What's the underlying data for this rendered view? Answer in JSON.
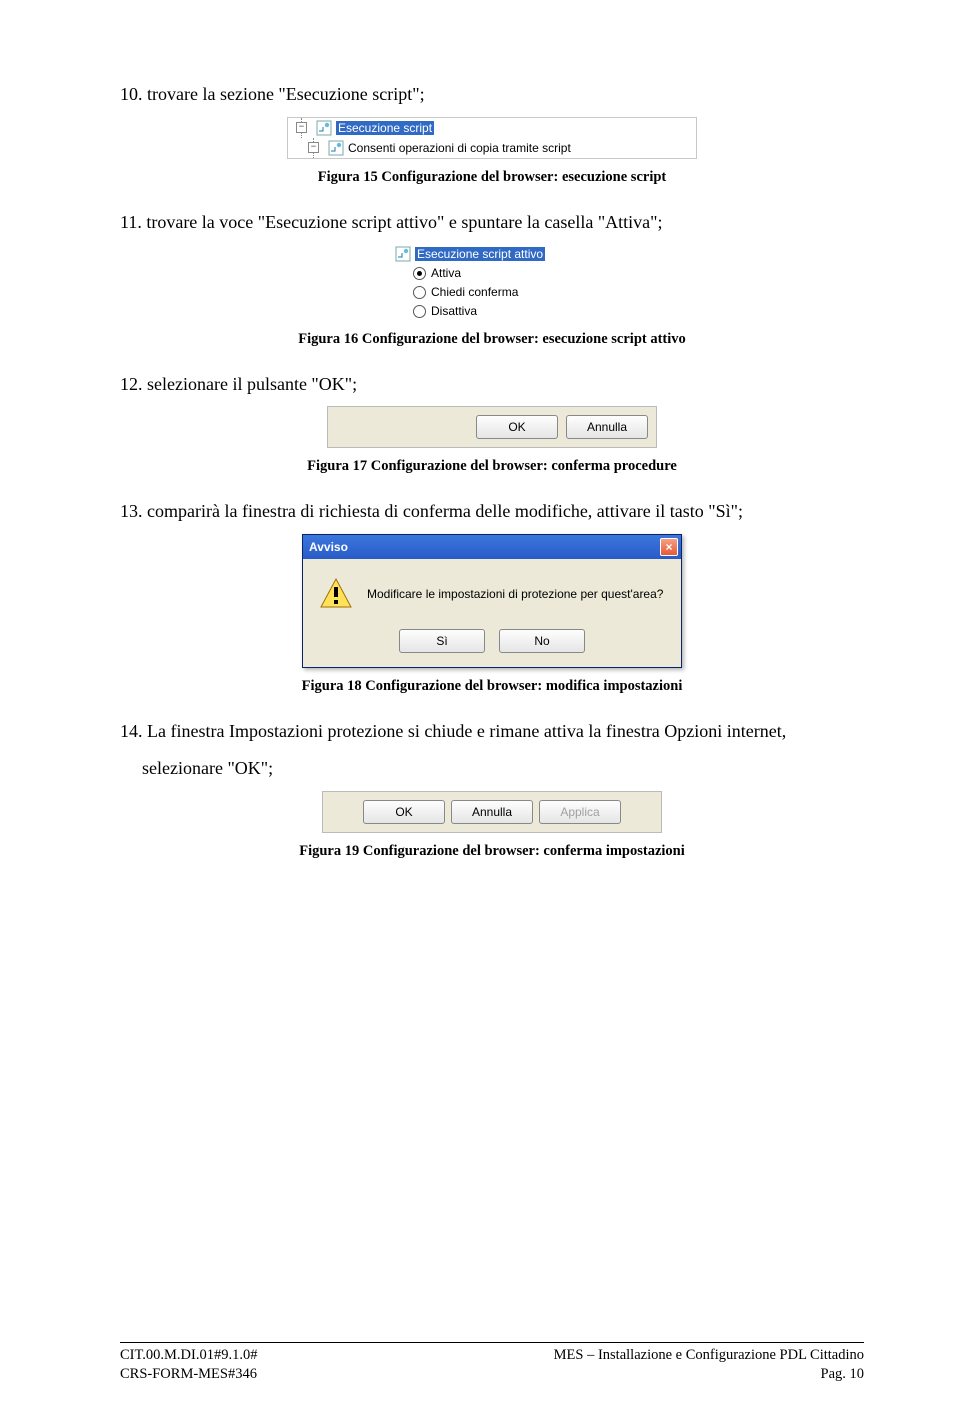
{
  "steps": {
    "s10": "10. trovare la sezione \"Esecuzione script\";",
    "s11": "11. trovare la voce \"Esecuzione script attivo\" e spuntare la casella \"Attiva\";",
    "s12": "12. selezionare il pulsante \"OK\";",
    "s13": "13. comparirà la finestra di richiesta di conferma delle modifiche, attivare il tasto \"Sì\";",
    "s14a": "14. La finestra Impostazioni protezione si chiude e rimane attiva la finestra Opzioni internet,",
    "s14b": "selezionare \"OK\";"
  },
  "captions": {
    "f15": "Figura 15 Configurazione del browser: esecuzione script",
    "f16": "Figura 16 Configurazione del browser: esecuzione script attivo",
    "f17": "Figura 17 Configurazione del browser: conferma procedure",
    "f18": "Figura 18 Configurazione del browser: modifica impostazioni",
    "f19": "Figura 19 Configurazione del browser: conferma impostazioni"
  },
  "fig15": {
    "row1": "Esecuzione script",
    "row2": "Consenti operazioni di copia tramite script"
  },
  "fig16": {
    "head": "Esecuzione script attivo",
    "opt1": "Attiva",
    "opt2": "Chiedi conferma",
    "opt3": "Disattiva"
  },
  "fig17": {
    "ok": "OK",
    "cancel": "Annulla"
  },
  "fig18": {
    "title": "Avviso",
    "msg": "Modificare le impostazioni di protezione per quest'area?",
    "yes": "Sì",
    "no": "No"
  },
  "fig19": {
    "ok": "OK",
    "cancel": "Annulla",
    "apply": "Applica"
  },
  "footer": {
    "l1": "CIT.00.M.DI.01#9.1.0#",
    "l2": "CRS-FORM-MES#346",
    "r1": "MES – Installazione e Configurazione PDL Cittadino",
    "r2": "Pag. 10"
  }
}
